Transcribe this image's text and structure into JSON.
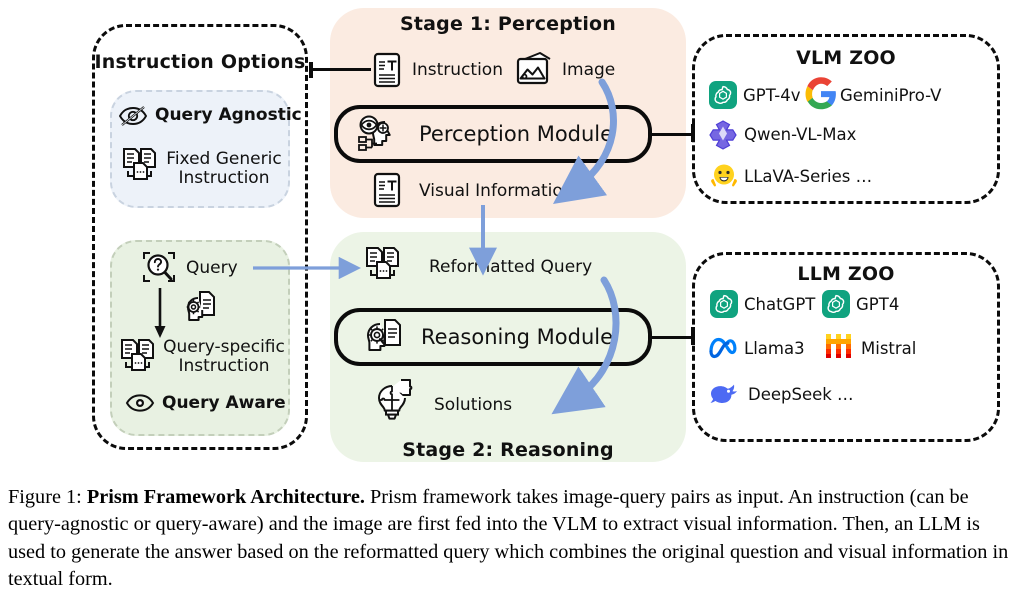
{
  "figure": {
    "instruction_options": {
      "title": "Instruction Options",
      "query_agnostic": {
        "mode_label": "Query Agnostic",
        "mode_icon": "eye-off-icon",
        "item_label": "Fixed Generic Instruction",
        "item_icon": "documents-icon"
      },
      "query_aware": {
        "query_label": "Query",
        "query_icon": "magnifier-question-icon",
        "transform_icon": "head-gear-document-icon",
        "instruction_label": "Query-specific Instruction",
        "instruction_icon": "documents-icon",
        "mode_label": "Query Aware",
        "mode_icon": "eye-icon"
      }
    },
    "stage1": {
      "title": "Stage 1: Perception",
      "inputs": [
        {
          "label": "Instruction",
          "icon": "text-document-icon"
        },
        {
          "label": "Image",
          "icon": "image-envelope-icon"
        }
      ],
      "module_label": "Perception Module",
      "module_icon": "head-eye-icon",
      "output": {
        "label": "Visual Information",
        "icon": "text-document-icon"
      }
    },
    "stage2": {
      "title": "Stage 2: Reasoning",
      "input": {
        "label": "Reformatted Query",
        "icon": "documents-icon"
      },
      "module_label": "Reasoning Module",
      "module_icon": "head-gear-document-icon",
      "output": {
        "label": "Solutions",
        "icon": "lightbulb-puzzle-icon"
      }
    },
    "vlm_zoo": {
      "title": "VLM ZOO",
      "models": [
        {
          "name": "GPT-4v",
          "icon": "openai-logo"
        },
        {
          "name": "GeminiPro-V",
          "icon": "google-logo"
        },
        {
          "name": "Qwen-VL-Max",
          "icon": "qwen-logo"
        },
        {
          "name": "LLaVA-Series …",
          "icon": "huggingface-logo"
        }
      ]
    },
    "llm_zoo": {
      "title": "LLM ZOO",
      "models": [
        {
          "name": "ChatGPT",
          "icon": "openai-logo"
        },
        {
          "name": "GPT4",
          "icon": "openai-logo"
        },
        {
          "name": "Llama3",
          "icon": "meta-logo"
        },
        {
          "name": "Mistral",
          "icon": "mistral-logo"
        },
        {
          "name": "DeepSeek …",
          "icon": "deepseek-logo"
        }
      ]
    },
    "colors": {
      "stage1_panel": "#FBEBE1",
      "stage2_panel": "#ECF4E6",
      "query_agnostic_card": "#EDF2F9",
      "query_aware_card": "#E8F1E2",
      "arrow_blue": "#7E9FDA",
      "outline": "#0b0b0b"
    }
  },
  "caption": {
    "prefix": "Figure 1:",
    "bold_title": "Prism Framework Architecture.",
    "body": "Prism framework takes image-query pairs as input. An instruction (can be query-agnostic or query-aware) and the image are first fed into the VLM to extract visual information.  Then, an LLM is used to generate the answer based on the reformatted query which combines the original question and visual information in textual form."
  }
}
